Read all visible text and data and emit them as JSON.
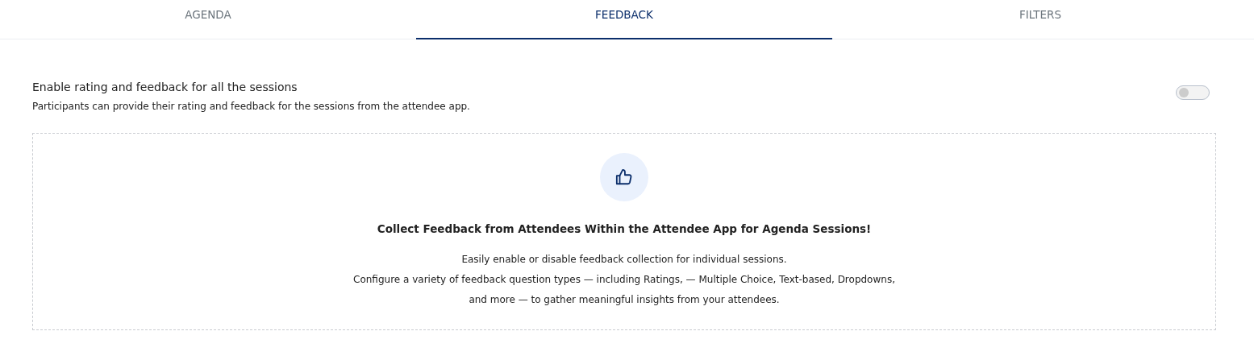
{
  "tabs": [
    {
      "label": "AGENDA",
      "selected": false
    },
    {
      "label": "FEEDBACK",
      "selected": true
    },
    {
      "label": "FILTERS",
      "selected": false
    }
  ],
  "setting": {
    "title": "Enable rating and feedback for all the sessions",
    "description": "Participants can provide their rating and feedback for the sessions from the attendee app.",
    "on": false
  },
  "empty_state": {
    "heading": "Collect Feedback from Attendees Within the Attendee App for Agenda Sessions!",
    "lines": [
      "Easily enable or disable feedback collection for individual sessions.",
      "Configure a variety of feedback question types — including Ratings, — Multiple Choice, Text-based, Dropdowns,",
      "and more — to gather meaningful insights from your attendees."
    ]
  }
}
